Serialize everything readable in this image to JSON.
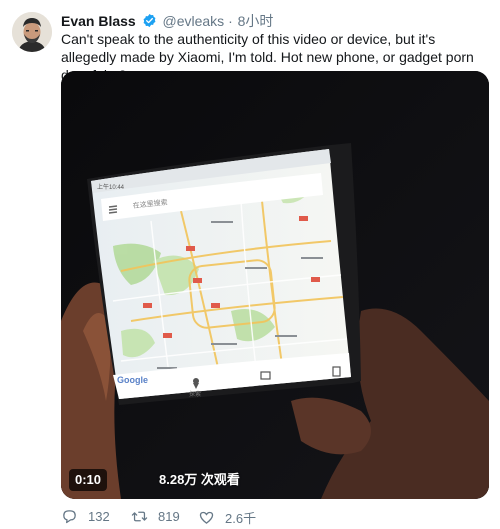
{
  "author": {
    "name": "Evan Blass",
    "handle": "@evleaks",
    "separator": "·",
    "time": "8小时"
  },
  "tweet": {
    "text": "Can't speak to the authenticity of this video or device, but it's allegedly made by Xiaomi, I'm told. Hot new phone, or gadget porn deepfake?"
  },
  "video": {
    "duration": "0:10",
    "views": "8.28万 次观看",
    "phone": {
      "status_time": "上午10:44",
      "search_placeholder": "在这里搜索",
      "map_brand": "Google",
      "nav_tab_label": "探索"
    }
  },
  "actions": {
    "reply_count": "132",
    "retweet_count": "819",
    "like_count": "2.6千"
  },
  "colors": {
    "verified": "#1da1f2",
    "meta": "#657786"
  }
}
